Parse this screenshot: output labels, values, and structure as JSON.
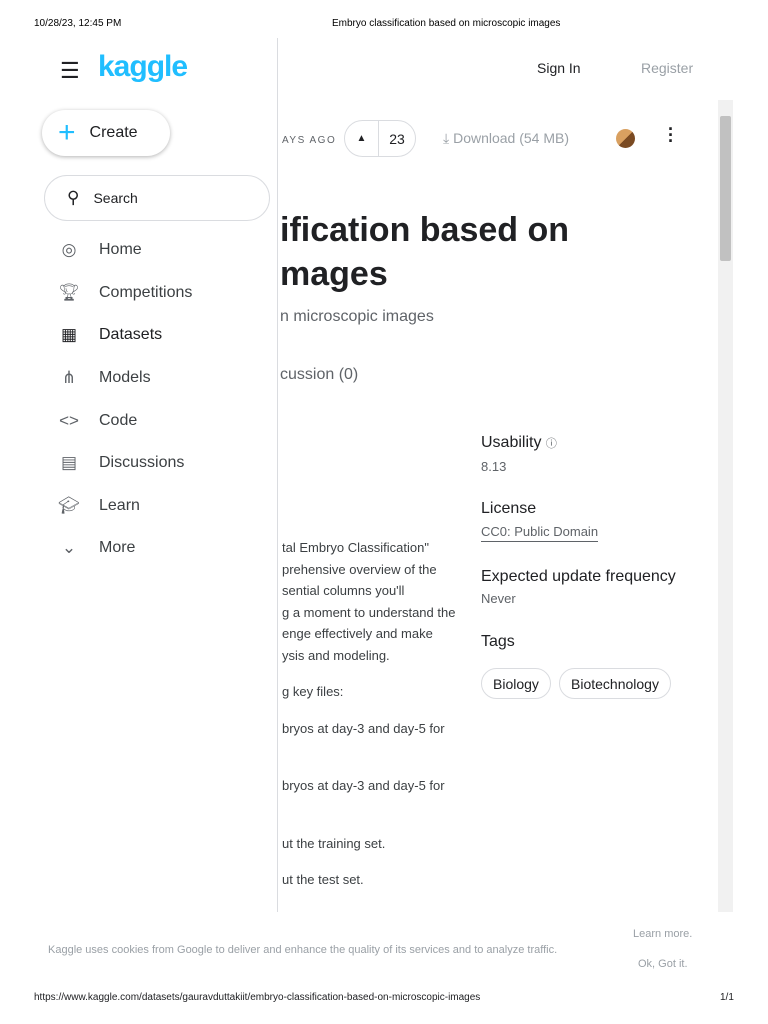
{
  "print_header": {
    "datetime": "10/28/23, 12:45 PM",
    "title": "Embryo classification based on microscopic images"
  },
  "print_footer": {
    "url": "https://www.kaggle.com/datasets/gauravduttakiit/embryo-classification-based-on-microscopic-images",
    "page": "1/1"
  },
  "brand": "kaggle",
  "top": {
    "sign_in": "Sign In",
    "register": "Register"
  },
  "sidebar": {
    "create": "Create",
    "search": "Search",
    "items": [
      {
        "label": "Home",
        "icon": "compass-icon"
      },
      {
        "label": "Competitions",
        "icon": "trophy-icon"
      },
      {
        "label": "Datasets",
        "icon": "table-icon"
      },
      {
        "label": "Models",
        "icon": "models-icon"
      },
      {
        "label": "Code",
        "icon": "code-icon"
      },
      {
        "label": "Discussions",
        "icon": "discussion-icon"
      },
      {
        "label": "Learn",
        "icon": "school-icon"
      },
      {
        "label": "More",
        "icon": "chevron-down-icon"
      }
    ]
  },
  "toolbar": {
    "updated": "AYS AGO",
    "votes": "23",
    "download": "Download (54 MB)"
  },
  "dataset": {
    "title_line1": "ification based on",
    "title_line2": "mages",
    "subtitle": "n microscopic images",
    "tab_discussion": "cussion (0)"
  },
  "description": [
    "tal Embryo Classification\"",
    "prehensive overview of the",
    "sential columns you'll",
    "g a moment to understand the",
    "enge effectively and make",
    "ysis and modeling.",
    "g key files:",
    "bryos at day-3 and day-5 for",
    "bryos at day-3 and day-5 for",
    "ut the training set.",
    "ut the test set."
  ],
  "meta": {
    "usability_label": "Usability",
    "usability_value": "8.13",
    "license_label": "License",
    "license_value": "CC0: Public Domain",
    "freq_label": "Expected update frequency",
    "freq_value": "Never",
    "tags_label": "Tags",
    "tags": [
      "Biology",
      "Biotechnology"
    ]
  },
  "cookie": {
    "text": "Kaggle uses cookies from Google to deliver and enhance the quality of its services and to analyze traffic.",
    "learn_more": "Learn more.",
    "ok": "Ok, Got it."
  }
}
